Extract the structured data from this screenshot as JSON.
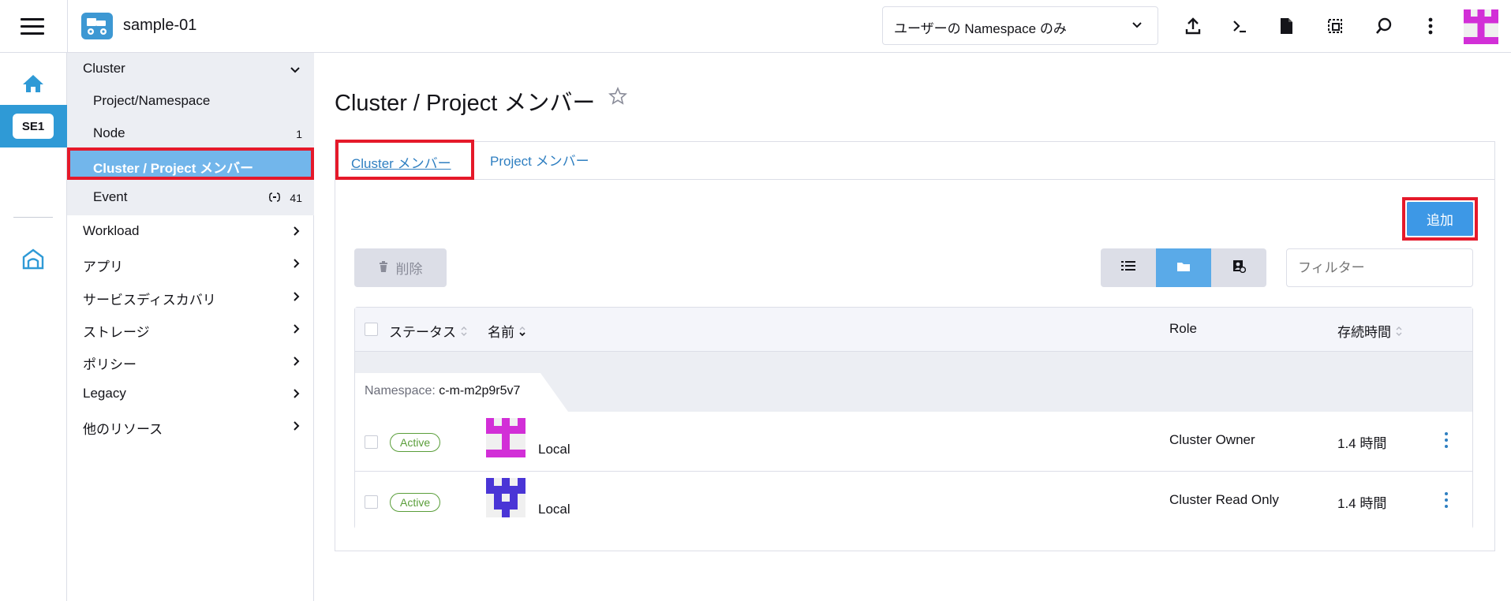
{
  "header": {
    "cluster_name": "sample-01",
    "namespace_filter": "ユーザーの Namespace のみ"
  },
  "rail": {
    "cluster_badge": "SE1"
  },
  "sidenav": {
    "group_label": "Cluster",
    "sub_items": [
      {
        "label": "Project/Namespace",
        "count": ""
      },
      {
        "label": "Node",
        "count": "1"
      },
      {
        "label": "Cluster / Project メンバー",
        "count": ""
      },
      {
        "label": "Event",
        "count": "41"
      }
    ],
    "items": [
      {
        "label": "Workload"
      },
      {
        "label": "アプリ"
      },
      {
        "label": "サービスディスカバリ"
      },
      {
        "label": "ストレージ"
      },
      {
        "label": "ポリシー"
      },
      {
        "label": "Legacy"
      },
      {
        "label": "他のリソース"
      }
    ]
  },
  "main": {
    "title": "Cluster / Project メンバー",
    "tabs": [
      {
        "label": "Cluster メンバー"
      },
      {
        "label": "Project メンバー"
      }
    ],
    "add_label": "追加",
    "delete_label": "削除",
    "filter_placeholder": "フィルター",
    "table": {
      "headers": [
        "ステータス",
        "名前",
        "Role",
        "存続時間"
      ],
      "group_label": "Namespace: ",
      "group_value": "c-m-m2p9r5v7",
      "rows": [
        {
          "status": "Active",
          "name": "Local",
          "role": "Cluster Owner",
          "age": "1.4 時間",
          "avatar_color": "#d22fd7"
        },
        {
          "status": "Active",
          "name": "Local",
          "role": "Cluster Read Only",
          "age": "1.4 時間",
          "avatar_color": "#4a35d6"
        }
      ]
    }
  },
  "colors": {
    "accent": "#3d98e6",
    "highlight": "#e5192a",
    "active_status": "#5a9e3a",
    "rail_active": "#2f9ad6"
  }
}
